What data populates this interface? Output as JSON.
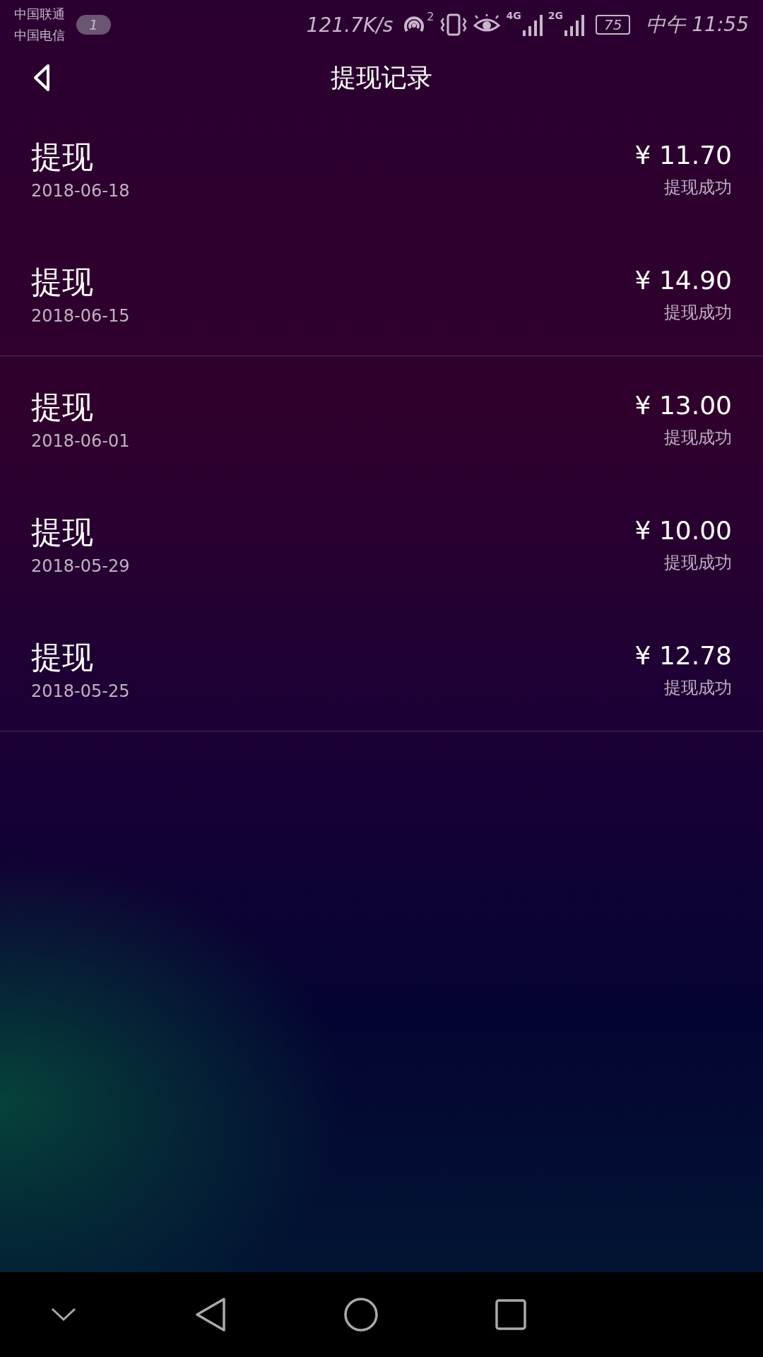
{
  "status_bar": {
    "carriers": [
      "中国联通",
      "中国电信"
    ],
    "badge": "1",
    "speed": "121.7K/s",
    "hotspot_count": "2",
    "network_1": "4G",
    "network_2": "2G",
    "battery": "75",
    "time": "中午 11:55"
  },
  "header": {
    "title": "提现记录"
  },
  "records": [
    {
      "title": "提现",
      "date": "2018-06-18",
      "amount": "¥ 11.70",
      "status": "提现成功",
      "divider": false
    },
    {
      "title": "提现",
      "date": "2018-06-15",
      "amount": "¥ 14.90",
      "status": "提现成功",
      "divider": true
    },
    {
      "title": "提现",
      "date": "2018-06-01",
      "amount": "¥ 13.00",
      "status": "提现成功",
      "divider": false
    },
    {
      "title": "提现",
      "date": "2018-05-29",
      "amount": "¥ 10.00",
      "status": "提现成功",
      "divider": false
    },
    {
      "title": "提现",
      "date": "2018-05-25",
      "amount": "¥ 12.78",
      "status": "提现成功",
      "divider": true
    }
  ]
}
